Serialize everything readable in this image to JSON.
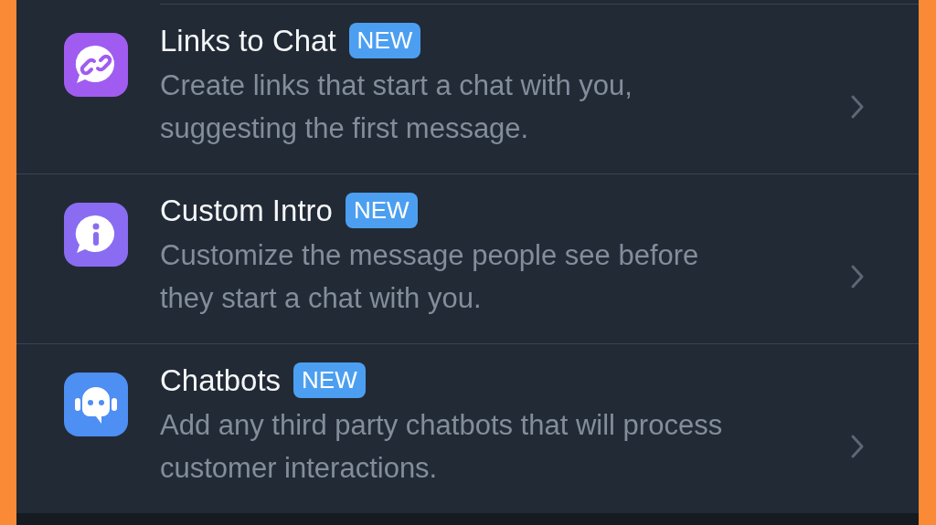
{
  "rows": [
    {
      "kind": "link",
      "color": "#a05cf0",
      "title": "Links to Chat",
      "badge": "NEW",
      "description": "Create links that start a chat with you, suggesting the first message."
    },
    {
      "kind": "info",
      "color": "#8a6cf2",
      "title": "Custom Intro",
      "badge": "NEW",
      "description": "Customize the message people see before they start a chat with you."
    },
    {
      "kind": "bot",
      "color": "#4d8ff2",
      "title": "Chatbots",
      "badge": "NEW",
      "description": "Add any third party chatbots that will process customer interactions."
    }
  ]
}
